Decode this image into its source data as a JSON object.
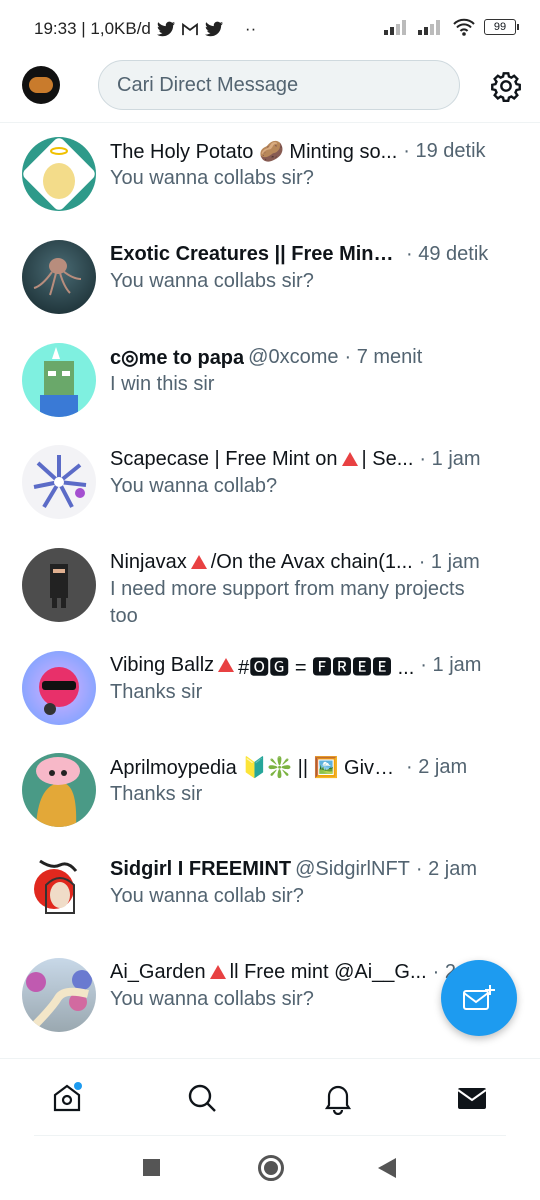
{
  "status_bar": {
    "time_speed": "19:33 | 1,0KB/d",
    "dots": "··",
    "battery": "99"
  },
  "header": {
    "search_placeholder": "Cari Direct Message"
  },
  "conversations": [
    {
      "name": "The Holy Potato 🥔 Minting so...",
      "handle": "",
      "time": "19 detik",
      "message": "You wanna collabs sir?",
      "bold": false
    },
    {
      "name": "Exotic Creatures || Free Mint ...",
      "handle": "",
      "time": "49 detik",
      "message": "You wanna collabs sir?",
      "bold": true
    },
    {
      "name": "c◎me to papa",
      "handle": "@0xcome",
      "time": "7 menit",
      "message": "I win this sir",
      "bold": true
    },
    {
      "name": "Scapecase | Free Mint on",
      "name_after": "| Se...",
      "handle": "",
      "time": "1 jam",
      "message": "You wanna collab?",
      "bold": false
    },
    {
      "name": "Ninjavax",
      "name_after": "/On the Avax chain(1...",
      "handle": "",
      "time": "1 jam",
      "message": "I need more support from many projects too",
      "bold": false
    },
    {
      "name": "Vibing Ballz",
      "name_after": "#🅾🅶 = 🅵🆁🅴🅴 ...",
      "handle": "",
      "time": "1 jam",
      "message": "Thanks sir",
      "bold": false
    },
    {
      "name": "Aprilmoypedia 🔰❇️ || 🖼️ Givea...",
      "handle": "",
      "time": "2 jam",
      "message": "Thanks sir",
      "bold": false
    },
    {
      "name": "Sidgirl I FREEMINT",
      "handle": "@SidgirlNFT",
      "time": "2 jam",
      "message": "You wanna collab sir?",
      "bold": true
    },
    {
      "name": "Ai_Garden",
      "name_after": "ll Free mint @Ai__G...",
      "handle": "",
      "time": "2",
      "message": "You wanna collabs sir?",
      "bold": false
    }
  ],
  "colors": {
    "accent": "#1d9bf0",
    "avax_red": "#e84142",
    "muted": "#536471"
  },
  "icons": [
    "home-icon",
    "search-icon",
    "bell-icon",
    "mail-icon",
    "gear-icon",
    "compose-message-icon"
  ]
}
